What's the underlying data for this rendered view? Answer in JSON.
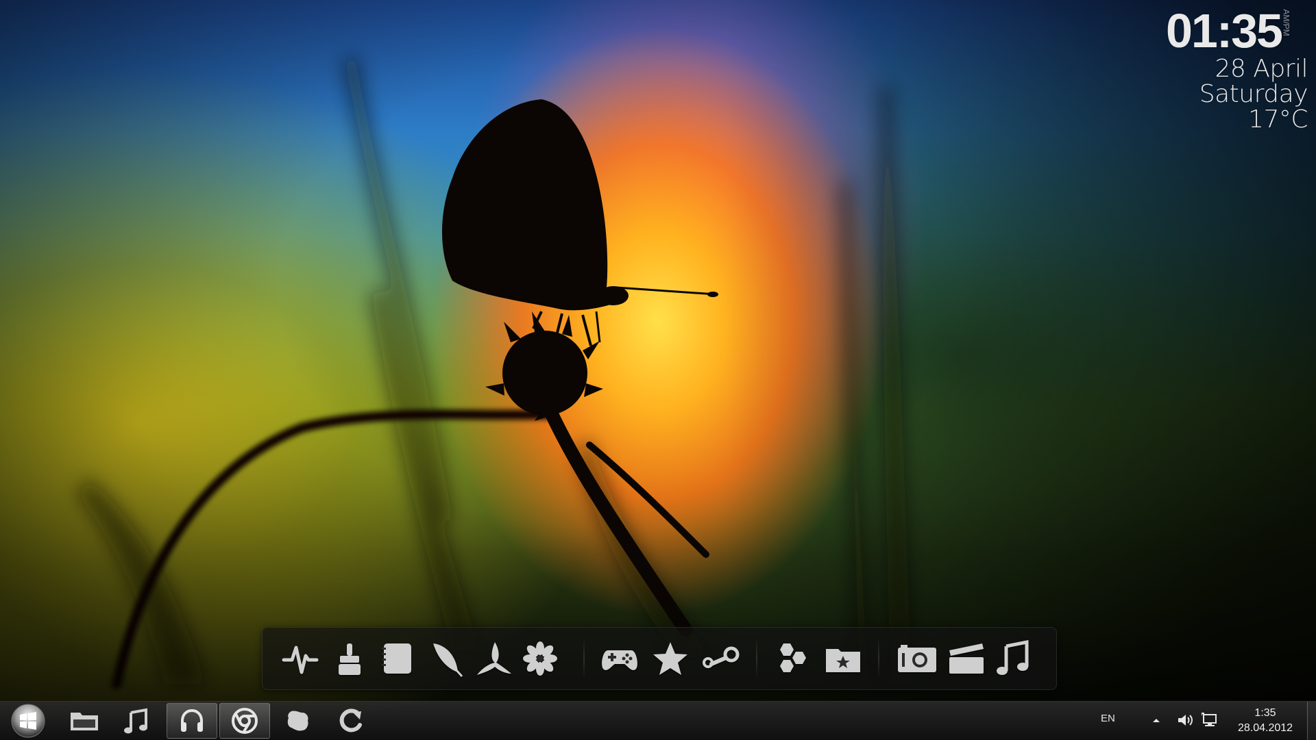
{
  "desktop": {
    "wallpaper_subject": "butterfly silhouette on a flower at sunset"
  },
  "clock_widget": {
    "time": "01:35",
    "ampm": "AM/PM",
    "date": "28 April",
    "weekday": "Saturday",
    "temperature": "17°C"
  },
  "dock": {
    "groups": [
      [
        "activity-monitor-icon",
        "cleaner-brush-icon",
        "notes-icon",
        "feather-writer-icon",
        "three-blade-app-icon",
        "flower-settings-icon"
      ],
      [
        "gamepad-icon",
        "star-favorites-icon",
        "steam-icon"
      ],
      [
        "hexagons-app-icon",
        "starred-folder-icon"
      ],
      [
        "camera-icon",
        "clapperboard-icon",
        "music-note-icon"
      ]
    ]
  },
  "taskbar": {
    "start_icon": "windows-orb-icon",
    "pinned": [
      {
        "icon": "folder-icon",
        "active": false
      },
      {
        "icon": "music-note-icon",
        "active": false
      },
      {
        "icon": "headphones-icon",
        "active": true
      },
      {
        "icon": "chrome-icon",
        "active": true
      },
      {
        "icon": "skype-icon",
        "active": false
      },
      {
        "icon": "refresh-arrow-icon",
        "active": false
      }
    ],
    "language": "EN",
    "tray_icons": [
      "show-hidden-icons-arrow",
      "volume-icon",
      "network-icon"
    ],
    "clock_time": "1:35",
    "clock_date": "28.04.2012"
  }
}
